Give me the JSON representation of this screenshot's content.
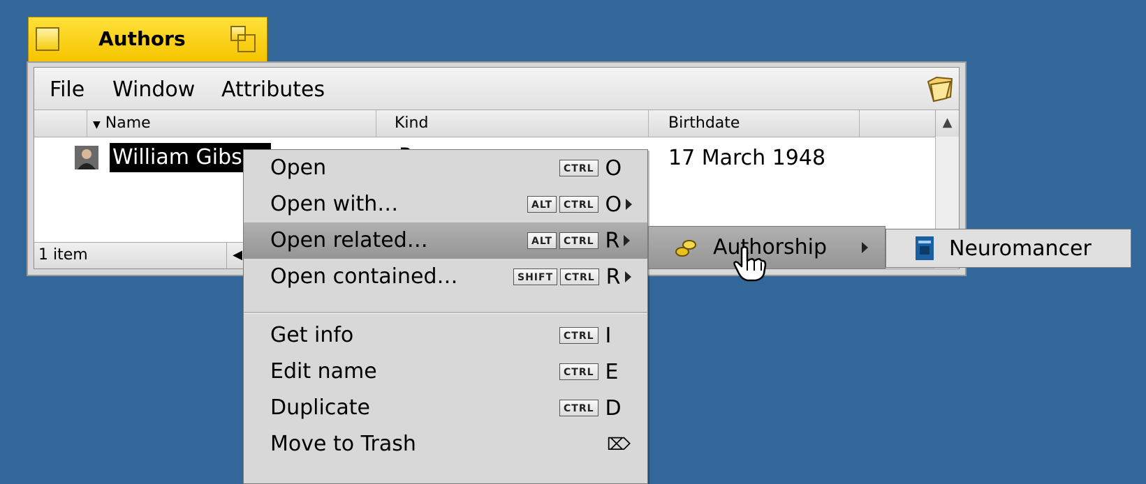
{
  "window": {
    "title": "Authors",
    "menu": [
      "File",
      "Window",
      "Attributes"
    ],
    "columns": [
      "Name",
      "Kind",
      "Birthdate"
    ],
    "rows": [
      {
        "name": "William Gibson",
        "kind": "P",
        "birthdate": "17 March 1948"
      }
    ],
    "status": "1 item"
  },
  "context_menu": {
    "items": [
      {
        "label": "Open",
        "keys": [
          "CTRL"
        ],
        "char": "O",
        "submenu": false
      },
      {
        "label": "Open with…",
        "keys": [
          "ALT",
          "CTRL"
        ],
        "char": "O",
        "submenu": true
      },
      {
        "label": "Open related…",
        "keys": [
          "ALT",
          "CTRL"
        ],
        "char": "R",
        "submenu": true,
        "highlighted": true
      },
      {
        "label": "Open contained…",
        "keys": [
          "SHIFT",
          "CTRL"
        ],
        "char": "R",
        "submenu": true
      },
      {
        "label": "Get info",
        "keys": [
          "CTRL"
        ],
        "char": "I",
        "submenu": false
      },
      {
        "label": "Edit name",
        "keys": [
          "CTRL"
        ],
        "char": "E",
        "submenu": false
      },
      {
        "label": "Duplicate",
        "keys": [
          "CTRL"
        ],
        "char": "D",
        "submenu": false
      },
      {
        "label": "Move to Trash",
        "keys": [],
        "char": "⌦",
        "submenu": false
      }
    ]
  },
  "submenu_related": {
    "label": "Authorship"
  },
  "submenu_authorship": {
    "label": "Neuromancer"
  },
  "colors": {
    "desktop": "#336699",
    "tab": "#f5c400",
    "menu_bg": "#d8d8d8",
    "highlight": "#a0a0a0"
  }
}
